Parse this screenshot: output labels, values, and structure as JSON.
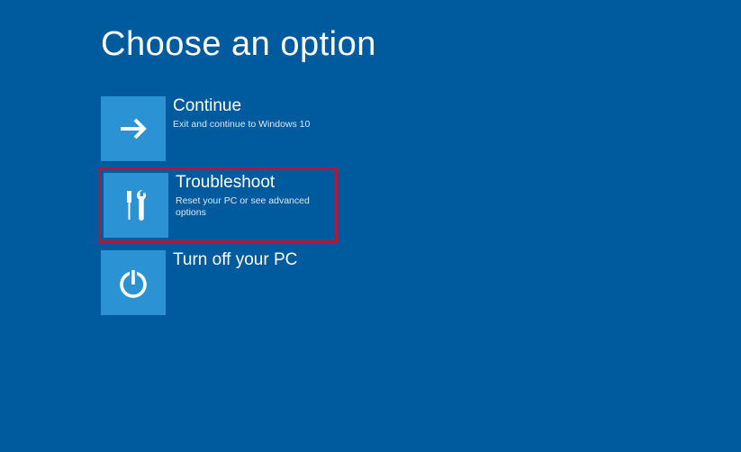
{
  "page": {
    "title": "Choose an option"
  },
  "options": {
    "continue": {
      "title": "Continue",
      "subtitle": "Exit and continue to Windows 10"
    },
    "troubleshoot": {
      "title": "Troubleshoot",
      "subtitle": "Reset your PC or see advanced options"
    },
    "turnoff": {
      "title": "Turn off your PC",
      "subtitle": ""
    }
  },
  "colors": {
    "background": "#005a9e",
    "tile": "#2b93d4",
    "highlight": "#b01834"
  }
}
